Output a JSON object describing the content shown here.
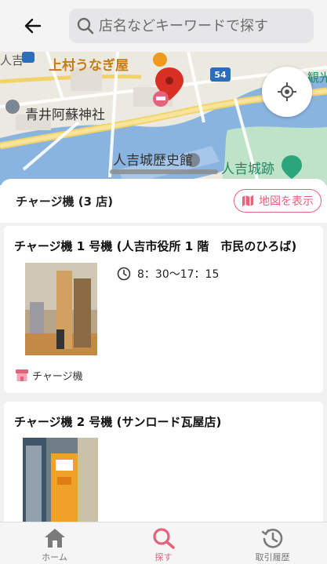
{
  "header": {
    "search_placeholder": "店名などキーワードで探す"
  },
  "map": {
    "labels": {
      "unagi": "上村うなぎ屋",
      "aoi": "青井阿蘇神社",
      "castle_history": "人吉城歴史館",
      "castle_ruins": "人吉城跡",
      "corner_hitoyoshi": "人吉",
      "corner_kan": "観光"
    },
    "route_number": "54"
  },
  "list": {
    "title": "チャージ機 (3 店)",
    "map_button_label": "地図を表示",
    "items": [
      {
        "name": "チャージ機 1 号機 (人吉市役所 1 階　市民のひろば)",
        "hours": "8：30〜17：15",
        "tag": "チャージ機"
      },
      {
        "name": "チャージ機 2 号機 (サンロード瓦屋店)"
      }
    ]
  },
  "nav": {
    "home": "ホーム",
    "search": "探す",
    "history": "取引履歴"
  },
  "colors": {
    "accent": "#e4627c",
    "map_water": "#8ab4e0",
    "map_park": "#bfe3c8"
  },
  "icons": {
    "back": "arrow-left-icon",
    "search": "search-icon",
    "locate": "crosshair-icon",
    "map": "map-icon",
    "clock": "clock-icon",
    "store": "store-icon",
    "home": "home-icon",
    "history": "history-icon"
  }
}
